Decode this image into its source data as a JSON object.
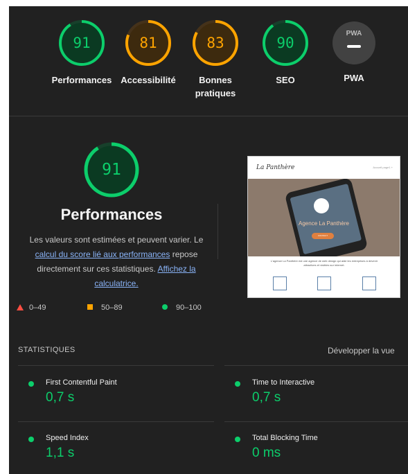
{
  "colors": {
    "pass": "#0cce6b",
    "average": "#ffa400",
    "fail": "#ff4e42",
    "background": "#212121",
    "link": "#8ab4f8"
  },
  "categories": [
    {
      "score": "91",
      "label": "Performances",
      "status": "pass"
    },
    {
      "score": "81",
      "label": "Accessibilité",
      "status": "average"
    },
    {
      "score": "83",
      "label": "Bonnes pratiques",
      "status": "average"
    },
    {
      "score": "90",
      "label": "SEO",
      "status": "pass"
    },
    {
      "score": "",
      "label": "PWA",
      "badge_text": "PWA",
      "icon": "pwa-badge-icon"
    }
  ],
  "performance": {
    "score": "91",
    "score_fraction": 0.91,
    "title": "Performances",
    "desc_before": "Les valeurs sont estimées et peuvent varier. Le ",
    "desc_link1": "calcul du score lié aux performances",
    "desc_middle": " repose directement sur ces statistiques. ",
    "desc_link2": "Affichez la calculatrice."
  },
  "legend": {
    "fail": "0–49",
    "average": "50–89",
    "pass": "90–100"
  },
  "screenshot_preview": {
    "logo": "La Panthère",
    "nav": "Accueil   page1 +",
    "hero_title": "Agence La Panthère",
    "button": "CONTACT",
    "paragraph": "L'agence La Panthère est une agence de web design qui aide les entreprises à devenir attractives et visibles sur internet."
  },
  "statistics": {
    "heading": "STATISTIQUES",
    "expand_label": "Développer la vue",
    "metrics": [
      {
        "label": "First Contentful Paint",
        "value": "0,7 s"
      },
      {
        "label": "Time to Interactive",
        "value": "0,7 s"
      },
      {
        "label": "Speed Index",
        "value": "1,1 s"
      },
      {
        "label": "Total Blocking Time",
        "value": "0 ms"
      }
    ]
  }
}
